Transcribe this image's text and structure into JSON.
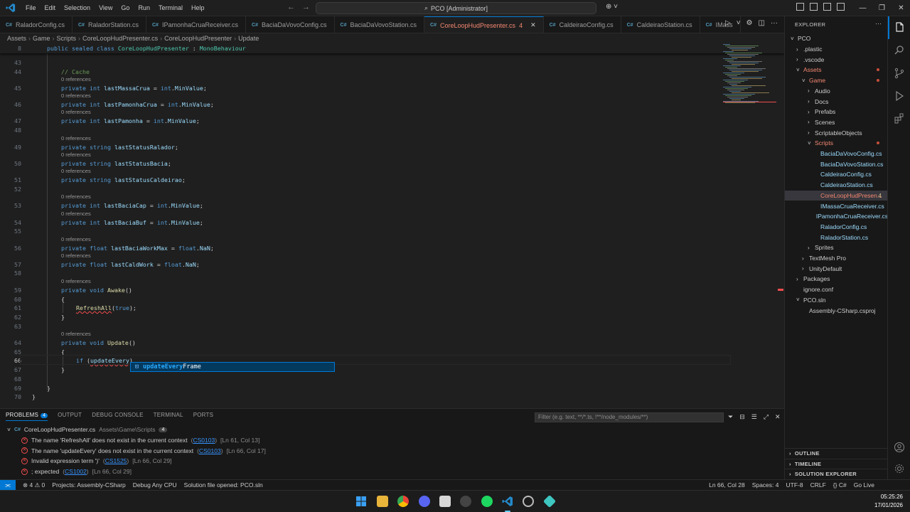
{
  "titlebar": {
    "menu": [
      "File",
      "Edit",
      "Selection",
      "View",
      "Go",
      "Run",
      "Terminal",
      "Help"
    ],
    "search_text": "PCO [Administrator]"
  },
  "tabs": [
    {
      "label": "RaladorConfig.cs",
      "active": false
    },
    {
      "label": "RaladorStation.cs",
      "active": false
    },
    {
      "label": "IPamonhaCruaReceiver.cs",
      "active": false
    },
    {
      "label": "BaciaDaVovoConfig.cs",
      "active": false
    },
    {
      "label": "BaciaDaVovoStation.cs",
      "active": false
    },
    {
      "label": "CoreLoopHudPresenter.cs",
      "active": true,
      "problems": "4"
    },
    {
      "label": "CaldeiraoConfig.cs",
      "active": false
    },
    {
      "label": "CaldeiraoStation.cs",
      "active": false
    },
    {
      "label": "IMass",
      "active": false
    }
  ],
  "breadcrumb": [
    "Assets",
    "Game",
    "Scripts",
    "CoreLoopHudPresenter.cs",
    "CoreLoopHudPresenter",
    "Update"
  ],
  "editor": {
    "sticky": {
      "num": "8",
      "text": "public sealed class CoreLoopHudPresenter : MonoBehaviour"
    },
    "lens": "0 references",
    "lines": [
      {
        "n": "43",
        "t": ""
      },
      {
        "n": "44",
        "t": "// Cache"
      },
      {
        "n": "45",
        "t": "private int lastMassaCrua = int.MinValue;"
      },
      {
        "n": "46",
        "t": "private int lastPamonhaCrua = int.MinValue;"
      },
      {
        "n": "47",
        "t": "private int lastPamonha = int.MinValue;"
      },
      {
        "n": "48",
        "t": ""
      },
      {
        "n": "49",
        "t": "private string lastStatusRalador;"
      },
      {
        "n": "50",
        "t": "private string lastStatusBacia;"
      },
      {
        "n": "51",
        "t": "private string lastStatusCaldeirao;"
      },
      {
        "n": "52",
        "t": ""
      },
      {
        "n": "53",
        "t": "private int lastBaciaCap = int.MinValue;"
      },
      {
        "n": "54",
        "t": "private int lastBaciaBuf = int.MinValue;"
      },
      {
        "n": "55",
        "t": ""
      },
      {
        "n": "56",
        "t": "private float lastBaciaWorkMax = float.NaN;"
      },
      {
        "n": "57",
        "t": "private float lastCaldWork = float.NaN;"
      },
      {
        "n": "58",
        "t": ""
      },
      {
        "n": "59",
        "t": "private void Awake()"
      },
      {
        "n": "60",
        "t": "{"
      },
      {
        "n": "61",
        "t": "RefreshAll(true);"
      },
      {
        "n": "62",
        "t": "}"
      },
      {
        "n": "63",
        "t": ""
      },
      {
        "n": "64",
        "t": "private void Update()"
      },
      {
        "n": "65",
        "t": "{"
      },
      {
        "n": "66",
        "t": "if (updateEvery)"
      },
      {
        "n": "67",
        "t": "}"
      },
      {
        "n": "68",
        "t": ""
      },
      {
        "n": "69",
        "t": "}"
      },
      {
        "n": "70",
        "t": "}"
      }
    ],
    "suggestion": {
      "match": "updateEvery",
      "rest": "Frame"
    }
  },
  "panel": {
    "tabs": [
      "PROBLEMS",
      "OUTPUT",
      "DEBUG CONSOLE",
      "TERMINAL",
      "PORTS"
    ],
    "problems_count": "4",
    "filter_placeholder": "Filter (e.g. text, **/*.ts, !**/node_modules/**)",
    "file": {
      "name": "CoreLoopHudPresenter.cs",
      "path": "Assets\\Game\\Scripts",
      "count": "4"
    },
    "problems": [
      {
        "msg": "The name 'RefreshAll' does not exist in the current context",
        "code": "CS0103",
        "loc": "[Ln 61, Col 13]"
      },
      {
        "msg": "The name 'updateEvery' does not exist in the current context",
        "code": "CS0103",
        "loc": "[Ln 66, Col 17]"
      },
      {
        "msg": "Invalid expression term ')'",
        "code": "CS1525",
        "loc": "[Ln 66, Col 29]"
      },
      {
        "msg": "; expected",
        "code": "CS1002",
        "loc": "[Ln 66, Col 29]"
      }
    ]
  },
  "explorer": {
    "title": "EXPLORER",
    "items": [
      {
        "label": "PCO",
        "depth": 0,
        "chev": "˅"
      },
      {
        "label": ".plastic",
        "depth": 1,
        "chev": "›"
      },
      {
        "label": ".vscode",
        "depth": 1,
        "chev": "›"
      },
      {
        "label": "Assets",
        "depth": 1,
        "chev": "˅",
        "dot": true,
        "color": "#f48771"
      },
      {
        "label": "Game",
        "depth": 2,
        "chev": "˅",
        "dot": true,
        "color": "#f48771"
      },
      {
        "label": "Audio",
        "depth": 3,
        "chev": "›"
      },
      {
        "label": "Docs",
        "depth": 3,
        "chev": "›"
      },
      {
        "label": "Prefabs",
        "depth": 3,
        "chev": "›"
      },
      {
        "label": "Scenes",
        "depth": 3,
        "chev": "›"
      },
      {
        "label": "ScriptableObjects",
        "depth": 3,
        "chev": "›"
      },
      {
        "label": "Scripts",
        "depth": 3,
        "chev": "˅",
        "dot": true,
        "color": "#f48771"
      },
      {
        "label": "BaciaDaVovoConfig.cs",
        "depth": 4,
        "chev": ""
      },
      {
        "label": "BaciaDaVovoStation.cs",
        "depth": 4,
        "chev": ""
      },
      {
        "label": "CaldeiraoConfig.cs",
        "depth": 4,
        "chev": ""
      },
      {
        "label": "CaldeiraoStation.cs",
        "depth": 4,
        "chev": ""
      },
      {
        "label": "CoreLoopHudPresen...",
        "depth": 4,
        "chev": "",
        "selected": true,
        "num": "4",
        "color": "#f48771"
      },
      {
        "label": "IMassaCruaReceiver.cs",
        "depth": 4,
        "chev": ""
      },
      {
        "label": "IPamonhaCruaReceiver.cs",
        "depth": 4,
        "chev": ""
      },
      {
        "label": "RaladorConfig.cs",
        "depth": 4,
        "chev": ""
      },
      {
        "label": "RaladorStation.cs",
        "depth": 4,
        "chev": ""
      },
      {
        "label": "Sprites",
        "depth": 3,
        "chev": "›"
      },
      {
        "label": "TextMesh Pro",
        "depth": 2,
        "chev": "›"
      },
      {
        "label": "UnityDefault",
        "depth": 2,
        "chev": "›"
      },
      {
        "label": "Packages",
        "depth": 1,
        "chev": "›"
      },
      {
        "label": "ignore.conf",
        "depth": 1,
        "chev": ""
      },
      {
        "label": "PCO.sln",
        "depth": 1,
        "chev": "˅"
      },
      {
        "label": "Assembly-CSharp.csproj",
        "depth": 2,
        "chev": ""
      }
    ],
    "sections": [
      "OUTLINE",
      "TIMELINE",
      "SOLUTION EXPLORER"
    ]
  },
  "statusbar": {
    "problems": "⊗ 4 ⚠ 0",
    "project": "Projects: Assembly-CSharp",
    "debug": "Debug Any CPU",
    "solution": "Solution file opened: PCO.sln",
    "position": "Ln 66, Col 28",
    "spaces": "Spaces: 4",
    "encoding": "UTF-8",
    "eol": "CRLF",
    "lang": "{} C#",
    "live": "Go Live"
  },
  "taskbar": {
    "time": "05:25:26",
    "date": "17/01/2026"
  },
  "colors": {
    "accent": "#0078d4",
    "error": "#f14c4c",
    "modified": "#f48771"
  }
}
